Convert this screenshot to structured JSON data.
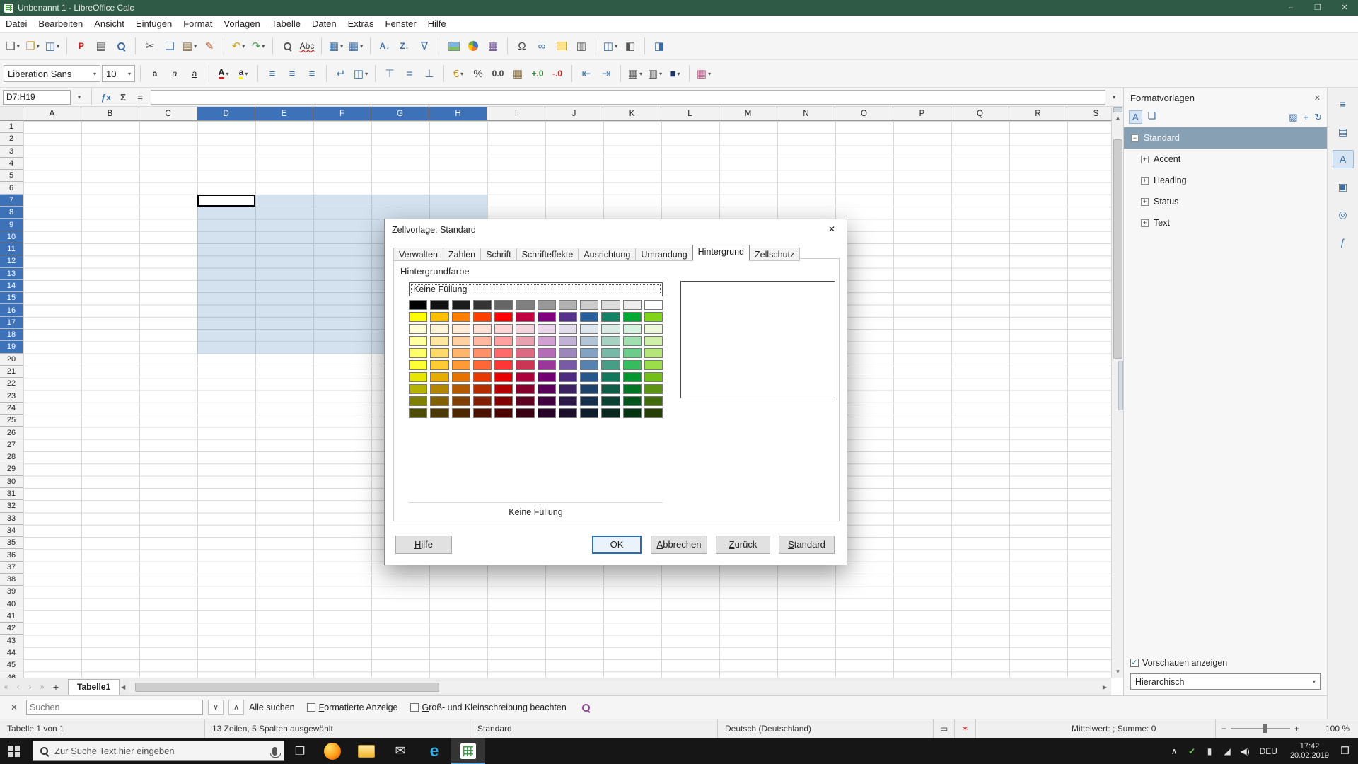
{
  "glyphs": {
    "dropdown": "▾",
    "check": "✓",
    "minus": "−",
    "plus": "+",
    "up": "▲",
    "down": "▼",
    "left": "◀",
    "right": "▶",
    "close": "✕",
    "chevron_up": "∧",
    "chevron_down": "∨",
    "selection_mode": "▭",
    "modified": "✶"
  },
  "window": {
    "title": "Unbenannt 1 - LibreOffice Calc",
    "minimize": "–",
    "maximize": "❐",
    "close": "✕"
  },
  "menubar": {
    "items": [
      "Datei",
      "Bearbeiten",
      "Ansicht",
      "Einfügen",
      "Format",
      "Vorlagen",
      "Tabelle",
      "Daten",
      "Extras",
      "Fenster",
      "Hilfe"
    ]
  },
  "toolbars": {
    "font_name": "Liberation Sans",
    "font_size": "10",
    "standard": [
      {
        "n": "new-document",
        "g": "❏",
        "c": "#555555",
        "dd": true
      },
      {
        "n": "open",
        "g": "❒",
        "c": "#c99a3c",
        "dd": true
      },
      {
        "n": "save",
        "g": "◫",
        "c": "#3a6ea5",
        "dd": true
      },
      {
        "sep": true
      },
      {
        "n": "export-as-pdf",
        "k": "text",
        "g": "P",
        "c": "#c9211e"
      },
      {
        "n": "print",
        "g": "▤",
        "c": "#555555"
      },
      {
        "n": "print-preview",
        "k": "mag",
        "c": "#3a6ea5"
      },
      {
        "sep": true
      },
      {
        "n": "cut",
        "g": "✂",
        "c": "#555555"
      },
      {
        "n": "copy",
        "g": "❑",
        "c": "#3a6ea5"
      },
      {
        "n": "paste",
        "g": "▤",
        "c": "#8a6d3b",
        "dd": true
      },
      {
        "n": "clone-formatting",
        "g": "✎",
        "c": "#b4532a"
      },
      {
        "sep": true
      },
      {
        "n": "undo",
        "g": "↶",
        "c": "#d6a315",
        "dd": true
      },
      {
        "n": "redo",
        "g": "↷",
        "c": "#4aa04a",
        "dd": true
      },
      {
        "sep": true
      },
      {
        "n": "find-and-replace",
        "k": "mag",
        "c": "#555555"
      },
      {
        "n": "spelling",
        "k": "text",
        "g": "Abc",
        "c": "#333333",
        "cls": "spell"
      },
      {
        "sep": true
      },
      {
        "n": "insert-rows",
        "g": "▦",
        "c": "#3a6ea5",
        "dd": true
      },
      {
        "n": "insert-columns",
        "g": "▦",
        "c": "#3a6ea5",
        "dd": true
      },
      {
        "sep": true
      },
      {
        "n": "sort-ascending",
        "k": "text",
        "g": "A↓",
        "c": "#3a6ea5"
      },
      {
        "n": "sort-descending",
        "k": "text",
        "g": "Z↓",
        "c": "#3a6ea5"
      },
      {
        "n": "autofilter",
        "g": "∇",
        "c": "#3a6ea5"
      },
      {
        "sep": true
      },
      {
        "n": "insert-image",
        "k": "img"
      },
      {
        "n": "insert-chart",
        "k": "chart"
      },
      {
        "n": "insert-pivot-table",
        "g": "▦",
        "c": "#6a4c93"
      },
      {
        "sep": true
      },
      {
        "n": "insert-special-character",
        "g": "Ω",
        "c": "#444444"
      },
      {
        "n": "insert-hyperlink",
        "g": "∞",
        "c": "#3a6ea5"
      },
      {
        "n": "insert-comment",
        "k": "note"
      },
      {
        "n": "headers-and-footers",
        "g": "▥",
        "c": "#555555"
      },
      {
        "sep": true
      },
      {
        "n": "freeze-rows-and-columns",
        "g": "◫",
        "c": "#3a6ea5",
        "dd": true
      },
      {
        "n": "split-window",
        "g": "◧",
        "c": "#555555"
      },
      {
        "sep": true
      },
      {
        "n": "sidebar-toggle",
        "g": "◨",
        "c": "#3a6ea5"
      }
    ],
    "formatting": [
      {
        "n": "bold",
        "k": "text",
        "g": "a",
        "cls": "fw-b",
        "c": "#222222"
      },
      {
        "n": "italic",
        "k": "text",
        "g": "a",
        "cls": "fs-i",
        "c": "#222222"
      },
      {
        "n": "underline",
        "k": "text",
        "g": "a",
        "cls": "td-u",
        "c": "#222222"
      },
      {
        "sep": true
      },
      {
        "n": "font-color",
        "k": "text",
        "g": "A",
        "cls": "fc",
        "c": "#222222",
        "dd": true
      },
      {
        "n": "highlighting-color",
        "k": "text",
        "g": "a",
        "cls": "hc",
        "c": "#222222",
        "dd": true
      },
      {
        "sep": true
      },
      {
        "n": "align-left",
        "g": "≡",
        "c": "#3a6ea5"
      },
      {
        "n": "align-center",
        "g": "≡",
        "c": "#3a6ea5"
      },
      {
        "n": "align-right",
        "g": "≡",
        "c": "#3a6ea5"
      },
      {
        "sep": true
      },
      {
        "n": "wrap-text",
        "g": "↵",
        "c": "#3a6ea5"
      },
      {
        "n": "merge-cells",
        "g": "◫",
        "c": "#3a6ea5",
        "dd": true
      },
      {
        "sep": true
      },
      {
        "n": "align-top",
        "g": "⊤",
        "c": "#3a6ea5"
      },
      {
        "n": "center-vertically",
        "g": "=",
        "c": "#3a6ea5"
      },
      {
        "n": "align-bottom",
        "g": "⊥",
        "c": "#3a6ea5"
      },
      {
        "sep": true
      },
      {
        "n": "format-as-currency",
        "g": "€",
        "c": "#b8860b",
        "dd": true
      },
      {
        "n": "format-as-percent",
        "g": "%",
        "c": "#444444"
      },
      {
        "n": "format-as-number",
        "k": "text",
        "g": "0.0",
        "c": "#444444"
      },
      {
        "n": "format-as-date",
        "g": "▦",
        "c": "#8a6d3b"
      },
      {
        "n": "add-decimal-place",
        "k": "text",
        "g": "+.0",
        "c": "#2e7d32"
      },
      {
        "n": "delete-decimal-place",
        "k": "text",
        "g": "-.0",
        "c": "#c62828"
      },
      {
        "sep": true
      },
      {
        "n": "decrease-indent",
        "g": "⇤",
        "c": "#3a6ea5"
      },
      {
        "n": "increase-indent",
        "g": "⇥",
        "c": "#3a6ea5"
      },
      {
        "sep": true
      },
      {
        "n": "borders",
        "g": "▦",
        "c": "#555555",
        "dd": true
      },
      {
        "n": "border-style",
        "g": "▥",
        "c": "#555555",
        "dd": true
      },
      {
        "n": "border-color",
        "g": "■",
        "c": "#1f3864",
        "dd": true
      },
      {
        "sep": true
      },
      {
        "n": "conditional-formatting",
        "g": "▦",
        "c": "#b85c8a",
        "dd": true
      }
    ]
  },
  "formula_bar": {
    "name_box": "D7:H19",
    "formula_value": "",
    "icons": [
      {
        "n": "function-wizard",
        "g": "ƒx",
        "c": "#3a6ea5"
      },
      {
        "n": "select-sum",
        "g": "Σ",
        "c": "#444444"
      },
      {
        "n": "insert-formula",
        "g": "=",
        "c": "#444444"
      }
    ]
  },
  "grid": {
    "columns": [
      "A",
      "B",
      "C",
      "D",
      "E",
      "F",
      "G",
      "H",
      "I",
      "J",
      "K",
      "L",
      "M",
      "N",
      "O",
      "P",
      "Q",
      "R",
      "S"
    ],
    "row_count": 46,
    "selection": {
      "range": "D7:H19",
      "col_start": 3,
      "col_end": 7,
      "row_start": 7,
      "row_end": 19
    }
  },
  "sheetbar": {
    "nav": [
      {
        "n": "first-sheet",
        "g": "«"
      },
      {
        "n": "previous-sheet",
        "g": "‹"
      },
      {
        "n": "next-sheet",
        "g": "›"
      },
      {
        "n": "last-sheet",
        "g": "»"
      }
    ],
    "add": "+",
    "tab": "Tabelle1"
  },
  "findbar": {
    "placeholder": "Suchen",
    "all_label": "Alle suchen",
    "checkbox1": "Formatierte Anzeige",
    "checkbox2": "Groß- und Kleinschreibung beachten"
  },
  "statusbar": {
    "sheet": "Tabelle 1 von 1",
    "selection": "13 Zeilen, 5 Spalten ausgewählt",
    "page_style": "Standard",
    "language": "Deutsch (Deutschland)",
    "sum": "Mittelwert: ; Summe: 0",
    "zoom": "100 %"
  },
  "sidebar": {
    "title": "Formatvorlagen",
    "toolbar_left": [
      {
        "n": "cell-styles",
        "g": "A",
        "active": true
      },
      {
        "n": "page-styles",
        "g": "❏"
      }
    ],
    "toolbar_right": [
      {
        "n": "fill-format-mode",
        "g": "▨"
      },
      {
        "n": "new-style-from-selection",
        "g": "+"
      },
      {
        "n": "update-style",
        "g": "↻"
      }
    ],
    "tree": [
      {
        "label": "Standard",
        "expander": "−",
        "level": 0,
        "selected": true
      },
      {
        "label": "Accent",
        "expander": "+",
        "level": 1
      },
      {
        "label": "Heading",
        "expander": "+",
        "level": 1
      },
      {
        "label": "Status",
        "expander": "+",
        "level": 1
      },
      {
        "label": "Text",
        "expander": "+",
        "level": 1
      }
    ],
    "preview_label": "Vorschauen anzeigen",
    "filter_value": "Hierarchisch",
    "rail": [
      {
        "n": "sidebar-settings",
        "g": "≡"
      },
      {
        "n": "properties-deck",
        "g": "▤"
      },
      {
        "n": "styles-deck",
        "g": "A",
        "active": true
      },
      {
        "n": "gallery-deck",
        "g": "▣"
      },
      {
        "n": "navigator-deck",
        "g": "◎"
      },
      {
        "n": "functions-deck",
        "g": "ƒ"
      }
    ]
  },
  "dialog": {
    "title": "Zellvorlage: Standard",
    "tabs": [
      "Verwalten",
      "Zahlen",
      "Schrift",
      "Schrifteffekte",
      "Ausrichtung",
      "Umrandung",
      "Hintergrund",
      "Zellschutz"
    ],
    "active_tab": "Hintergrund",
    "section_label": "Hintergrundfarbe",
    "none_fill_option": "Keine Füllung",
    "selected_name": "Keine Füllung",
    "buttons": {
      "help": "Hilfe",
      "ok": "OK",
      "cancel": "Abbrechen",
      "back": "Zurück",
      "standard": "Standard"
    },
    "palette": [
      [
        "#000000",
        "#111111",
        "#1C1C1C",
        "#333333",
        "#666666",
        "#808080",
        "#999999",
        "#B2B2B2",
        "#CCCCCC",
        "#DDDDDD",
        "#EEEEEE",
        "#FFFFFF"
      ],
      [
        "#FFFF00",
        "#FFBF00",
        "#FF8000",
        "#FF4000",
        "#FF0000",
        "#BF0041",
        "#800080",
        "#55308D",
        "#2A6099",
        "#158466",
        "#00A933",
        "#81D41A"
      ],
      [
        "#FFFFD6",
        "#FFF4D6",
        "#FFEBD6",
        "#FFE0D6",
        "#FFD6D6",
        "#F5D6DE",
        "#EBD6EB",
        "#E4DDED",
        "#DDE6EF",
        "#DAEBE6",
        "#D6F1DE",
        "#EBF6DA"
      ],
      [
        "#FFFFA1",
        "#FFE7A1",
        "#FFD0A1",
        "#FFB8A1",
        "#FFA1A1",
        "#E7A1B0",
        "#D0A1D0",
        "#C0B2D5",
        "#B3C4D7",
        "#A6D1C3",
        "#A1DFB1",
        "#D0EFAA"
      ],
      [
        "#FFFF6B",
        "#FFDA6B",
        "#FFB56B",
        "#FF906B",
        "#FF6B6B",
        "#DA6B82",
        "#B56BB5",
        "#9C87BD",
        "#83A2C4",
        "#77B8A6",
        "#6BCD89",
        "#B6E67A"
      ],
      [
        "#FFFF36",
        "#FFCC36",
        "#FF9B36",
        "#FF6836",
        "#FF3636",
        "#CC3655",
        "#9B369B",
        "#795BA5",
        "#5781AE",
        "#469E86",
        "#36BB5E",
        "#9BDD4A"
      ],
      [
        "#E6E600",
        "#E6AC00",
        "#E67300",
        "#E63A00",
        "#E60000",
        "#AC003B",
        "#730073",
        "#4D2B7F",
        "#26568A",
        "#13775C",
        "#00982E",
        "#74BF17"
      ],
      [
        "#B3B300",
        "#B38600",
        "#B35A00",
        "#B32D00",
        "#B30000",
        "#86002E",
        "#5A005A",
        "#3C2263",
        "#1D436B",
        "#0F5C47",
        "#007624",
        "#5A9412"
      ],
      [
        "#808000",
        "#806000",
        "#804000",
        "#802000",
        "#800000",
        "#600021",
        "#400040",
        "#2B1847",
        "#15304D",
        "#0B4233",
        "#00551A",
        "#416A0D"
      ],
      [
        "#4D4D00",
        "#4D3900",
        "#4D2600",
        "#4D1300",
        "#4D0000",
        "#390014",
        "#260026",
        "#1A0E2A",
        "#0D1D2E",
        "#06281F",
        "#00330F",
        "#274008"
      ]
    ]
  },
  "taskbar": {
    "search_placeholder": "Zur Suche Text hier eingeben",
    "task_view_glyph": "❐",
    "apps": [
      {
        "n": "firefox",
        "k": "ff"
      },
      {
        "n": "file-explorer",
        "k": "fe"
      },
      {
        "n": "mail",
        "k": "mail",
        "g": "✉"
      },
      {
        "n": "edge",
        "k": "edge",
        "g": "e"
      },
      {
        "n": "libreoffice-calc",
        "k": "calc",
        "active": true
      }
    ],
    "tray": [
      {
        "n": "hidden-icons",
        "g": "∧"
      },
      {
        "n": "security-status",
        "g": "✔",
        "c": "#6abf4b"
      },
      {
        "n": "battery",
        "g": "▮"
      },
      {
        "n": "network",
        "g": "◢"
      },
      {
        "n": "volume",
        "g": "◀)"
      }
    ],
    "tray_language": "DEU",
    "time": "17:42",
    "date": "20.02.2019",
    "action_center_glyph": "❒"
  }
}
